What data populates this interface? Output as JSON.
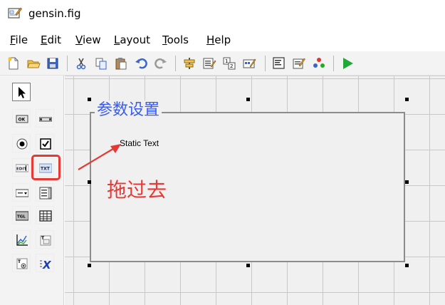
{
  "window": {
    "title": "gensin.fig",
    "icon": "figure-edit-icon"
  },
  "menu": {
    "items": [
      {
        "label": "File",
        "mnemonic": "F",
        "rest": "ile"
      },
      {
        "label": "Edit",
        "mnemonic": "E",
        "rest": "dit"
      },
      {
        "label": "View",
        "mnemonic": "V",
        "rest": "iew"
      },
      {
        "label": "Layout",
        "mnemonic": "L",
        "rest": "ayout"
      },
      {
        "label": "Tools",
        "mnemonic": "T",
        "rest": "ools"
      },
      {
        "label": "Help",
        "mnemonic": "H",
        "rest": "elp"
      }
    ]
  },
  "toolbar": {
    "buttons": [
      "new-file-icon",
      "open-folder-icon",
      "save-icon",
      "cut-icon",
      "copy-icon",
      "paste-icon",
      "undo-icon",
      "redo-icon",
      "align-icon",
      "menu-editor-icon",
      "tab-order-icon",
      "toolbar-editor-icon",
      "editor-icon",
      "property-inspector-icon",
      "object-browser-icon",
      "run-icon"
    ]
  },
  "palette": {
    "tools": [
      {
        "name": "select-tool",
        "label": ""
      },
      {
        "name": "push-button-tool",
        "label": "OK"
      },
      {
        "name": "slider-tool",
        "label": ""
      },
      {
        "name": "radio-button-tool",
        "label": ""
      },
      {
        "name": "check-box-tool",
        "label": ""
      },
      {
        "name": "edit-text-tool",
        "label": "EDIT"
      },
      {
        "name": "static-text-tool",
        "label": "TXT"
      },
      {
        "name": "popup-menu-tool",
        "label": ""
      },
      {
        "name": "listbox-tool",
        "label": ""
      },
      {
        "name": "toggle-button-tool",
        "label": "TGL"
      },
      {
        "name": "table-tool",
        "label": ""
      },
      {
        "name": "axes-tool",
        "label": ""
      },
      {
        "name": "panel-tool",
        "label": ""
      },
      {
        "name": "button-group-tool",
        "label": ""
      },
      {
        "name": "activex-tool",
        "label": ""
      }
    ]
  },
  "canvas": {
    "panel_title": "参数设置",
    "static_text": "Static Text"
  },
  "annotation": {
    "label": "拖过去",
    "color": "#e53935"
  },
  "colors": {
    "panel_title": "#3a5bf0",
    "highlight": "#e53935",
    "run": "#22a83a"
  }
}
